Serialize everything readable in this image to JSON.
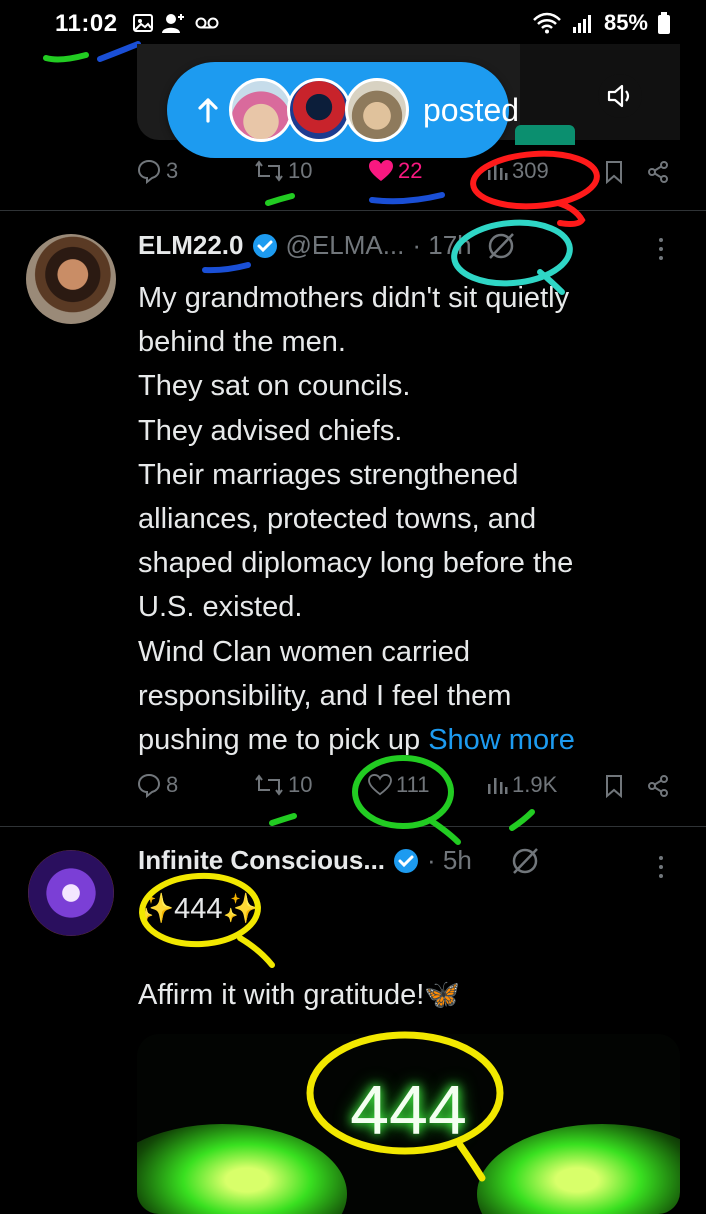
{
  "status_bar": {
    "time": "11:02",
    "battery": "85%"
  },
  "feed_pill": {
    "label": "posted"
  },
  "post1": {
    "replies": "3",
    "reposts": "10",
    "likes": "22",
    "views": "309"
  },
  "post2": {
    "display_name": "ELM22.0",
    "handle": "@ELMA...",
    "time": "· 17h",
    "lines": [
      "My grandmothers didn't sit quietly",
      "behind the men.",
      "They sat on councils.",
      "They advised chiefs.",
      "Their marriages strengthened",
      "alliances, protected towns, and",
      "shaped diplomacy long before the",
      "U.S. existed.",
      "Wind Clan women carried",
      "responsibility, and I feel them",
      "pushing me to pick up"
    ],
    "show_more": "Show more",
    "replies": "8",
    "reposts": "10",
    "likes": "111",
    "views": "1.9K"
  },
  "post3": {
    "display_name": "Infinite Conscious...",
    "time": "· 5h",
    "line1": "✨444✨",
    "line2": "Affirm it with gratitude!🦋",
    "image_text": "444"
  },
  "colors": {
    "accent": "#1d9bf0",
    "like_pink": "#f91880",
    "muted": "#71767b",
    "annotation_green": "#22cc22",
    "annotation_blue": "#1a4fd6",
    "annotation_red": "#ff1a1a",
    "annotation_cyan": "#2fd6c6",
    "annotation_yellow": "#f2e800"
  }
}
